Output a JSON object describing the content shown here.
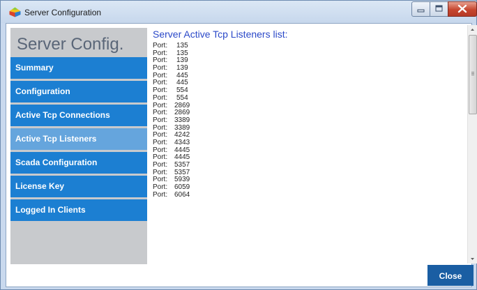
{
  "window": {
    "title": "Server Configuration"
  },
  "sidebar": {
    "title": "Server Config.",
    "items": [
      {
        "label": "Summary"
      },
      {
        "label": "Configuration"
      },
      {
        "label": "Active Tcp Connections"
      },
      {
        "label": "Active Tcp Listeners",
        "selected": true
      },
      {
        "label": "Scada Configuration"
      },
      {
        "label": "License Key"
      },
      {
        "label": "Logged In Clients"
      }
    ]
  },
  "main": {
    "title": "Server Active Tcp Listeners list:",
    "port_label": "Port:",
    "ports": [
      "135",
      "135",
      "139",
      "139",
      "445",
      "445",
      "554",
      "554",
      "2869",
      "2869",
      "3389",
      "3389",
      "4242",
      "4343",
      "4445",
      "4445",
      "5357",
      "5357",
      "5939",
      "6059",
      "6064"
    ]
  },
  "footer": {
    "close_label": "Close"
  },
  "colors": {
    "nav_item": "#1c7fd2",
    "nav_item_selected": "#65a5dd",
    "content_title": "#2a48c8",
    "close_button": "#1a5ea3",
    "sidebar_bg": "#c8cacd"
  },
  "icons": {
    "app": "app-icon",
    "minimize": "minimize-icon",
    "maximize": "maximize-icon",
    "close": "close-icon",
    "scroll_up": "scroll-up-arrow-icon",
    "scroll_down": "scroll-down-arrow-icon"
  }
}
